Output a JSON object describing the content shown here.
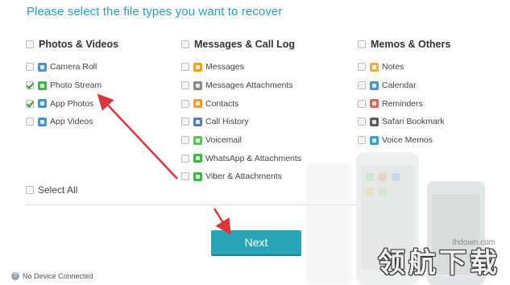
{
  "title": "Please select the file types you want to recover",
  "columns": [
    {
      "heading": "Photos & Videos",
      "checked": false,
      "items": [
        {
          "label": "Camera Roll",
          "checked": false,
          "icon": "camera-icon",
          "color": "#4a90d9"
        },
        {
          "label": "Photo Stream",
          "checked": true,
          "icon": "photo-stream-icon",
          "color": "#3cb84a"
        },
        {
          "label": "App Photos",
          "checked": true,
          "icon": "app-photos-icon",
          "color": "#4a90d9"
        },
        {
          "label": "App Videos",
          "checked": false,
          "icon": "app-videos-icon",
          "color": "#4a90d9"
        }
      ]
    },
    {
      "heading": "Messages & Call Log",
      "checked": false,
      "items": [
        {
          "label": "Messages",
          "checked": false,
          "icon": "messages-icon",
          "color": "#f0a020"
        },
        {
          "label": "Messages Attachments",
          "checked": false,
          "icon": "attachment-icon",
          "color": "#8a8a8a"
        },
        {
          "label": "Contacts",
          "checked": false,
          "icon": "contacts-icon",
          "color": "#f0a020"
        },
        {
          "label": "Call History",
          "checked": false,
          "icon": "call-history-icon",
          "color": "#5b7fa6"
        },
        {
          "label": "Voicemail",
          "checked": false,
          "icon": "voicemail-icon",
          "color": "#5fc35a"
        },
        {
          "label": "WhatsApp & Attachments",
          "checked": false,
          "icon": "whatsapp-icon",
          "color": "#3cb84a"
        },
        {
          "label": "Viber & Attachments",
          "checked": false,
          "icon": "viber-icon",
          "color": "#3cb84a"
        }
      ]
    },
    {
      "heading": "Memos & Others",
      "checked": false,
      "items": [
        {
          "label": "Notes",
          "checked": false,
          "icon": "notes-icon",
          "color": "#e8b62a"
        },
        {
          "label": "Calendar",
          "checked": false,
          "icon": "calendar-icon",
          "color": "#4a90d9"
        },
        {
          "label": "Reminders",
          "checked": false,
          "icon": "reminders-icon",
          "color": "#e2664e"
        },
        {
          "label": "Safari Bookmark",
          "checked": false,
          "icon": "safari-bookmark-icon",
          "color": "#5d5d5d"
        },
        {
          "label": "Voice Memos",
          "checked": false,
          "icon": "voice-memos-icon",
          "color": "#34a3d0"
        }
      ]
    }
  ],
  "select_all": {
    "label": "Select All",
    "checked": false
  },
  "next_button": {
    "label": "Next"
  },
  "status": {
    "text": "No Device Connected",
    "icon": "help-icon"
  },
  "watermark": {
    "url": "lhdown.com",
    "text": "领航下载"
  },
  "colors": {
    "accent": "#2aa4b7",
    "title": "#2a9fb3",
    "annotation_arrow": "#d9363e"
  }
}
